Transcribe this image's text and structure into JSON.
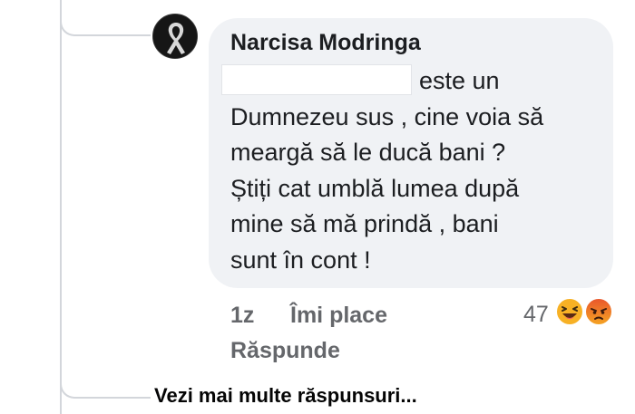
{
  "comment": {
    "author": "Narcisa Modringa",
    "lines": [
      "este un",
      "Dumnezeu sus , cine voia să",
      "meargă să le ducă bani ?",
      "Știți cat umblă lumea după",
      "mine să mă prindă , bani",
      "sunt în cont !"
    ]
  },
  "actions": {
    "time": "1z",
    "like_label": "Îmi place",
    "reply_label": "Răspunde",
    "reaction_count": "47",
    "reactions": [
      "haha-reaction-icon",
      "angry-reaction-icon"
    ]
  },
  "thread": {
    "more_replies_label": "Vezi mai multe răspunsuri..."
  },
  "colors": {
    "bubble": "#f0f2f5",
    "text": "#1c1e21",
    "meta": "#65676b",
    "reaction_yellow": "#f7b125",
    "reaction_red": "#e9542c"
  }
}
